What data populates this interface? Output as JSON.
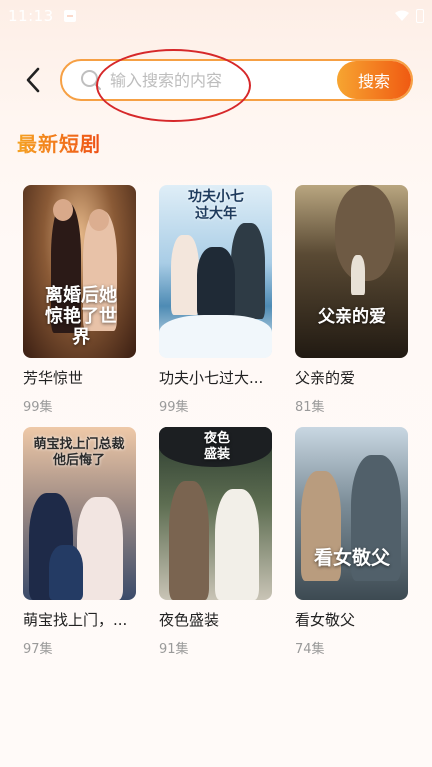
{
  "status_bar": {
    "time": "11:13"
  },
  "search": {
    "placeholder": "输入搜索的内容",
    "button_label": "搜索"
  },
  "section": {
    "title": "最新短剧"
  },
  "dramas": [
    {
      "title": "芳华惊世",
      "episodes": "99集",
      "poster_text": "离婚后她惊艳了世界"
    },
    {
      "title": "功夫小七过大...",
      "episodes": "99集",
      "poster_text": "功夫小七过大年"
    },
    {
      "title": "父亲的爱",
      "episodes": "81集",
      "poster_text": "父亲的爱"
    },
    {
      "title": "萌宝找上门，...",
      "episodes": "97集",
      "poster_text": "萌宝找上门总裁他后悔了"
    },
    {
      "title": "夜色盛装",
      "episodes": "91集",
      "poster_text": "夜色盛装"
    },
    {
      "title": "看女敬父",
      "episodes": "74集",
      "poster_text": "看女敬父"
    }
  ],
  "colors": {
    "accent_start": "#f7a531",
    "accent_end": "#f05a12",
    "annotation": "#d6282a"
  }
}
